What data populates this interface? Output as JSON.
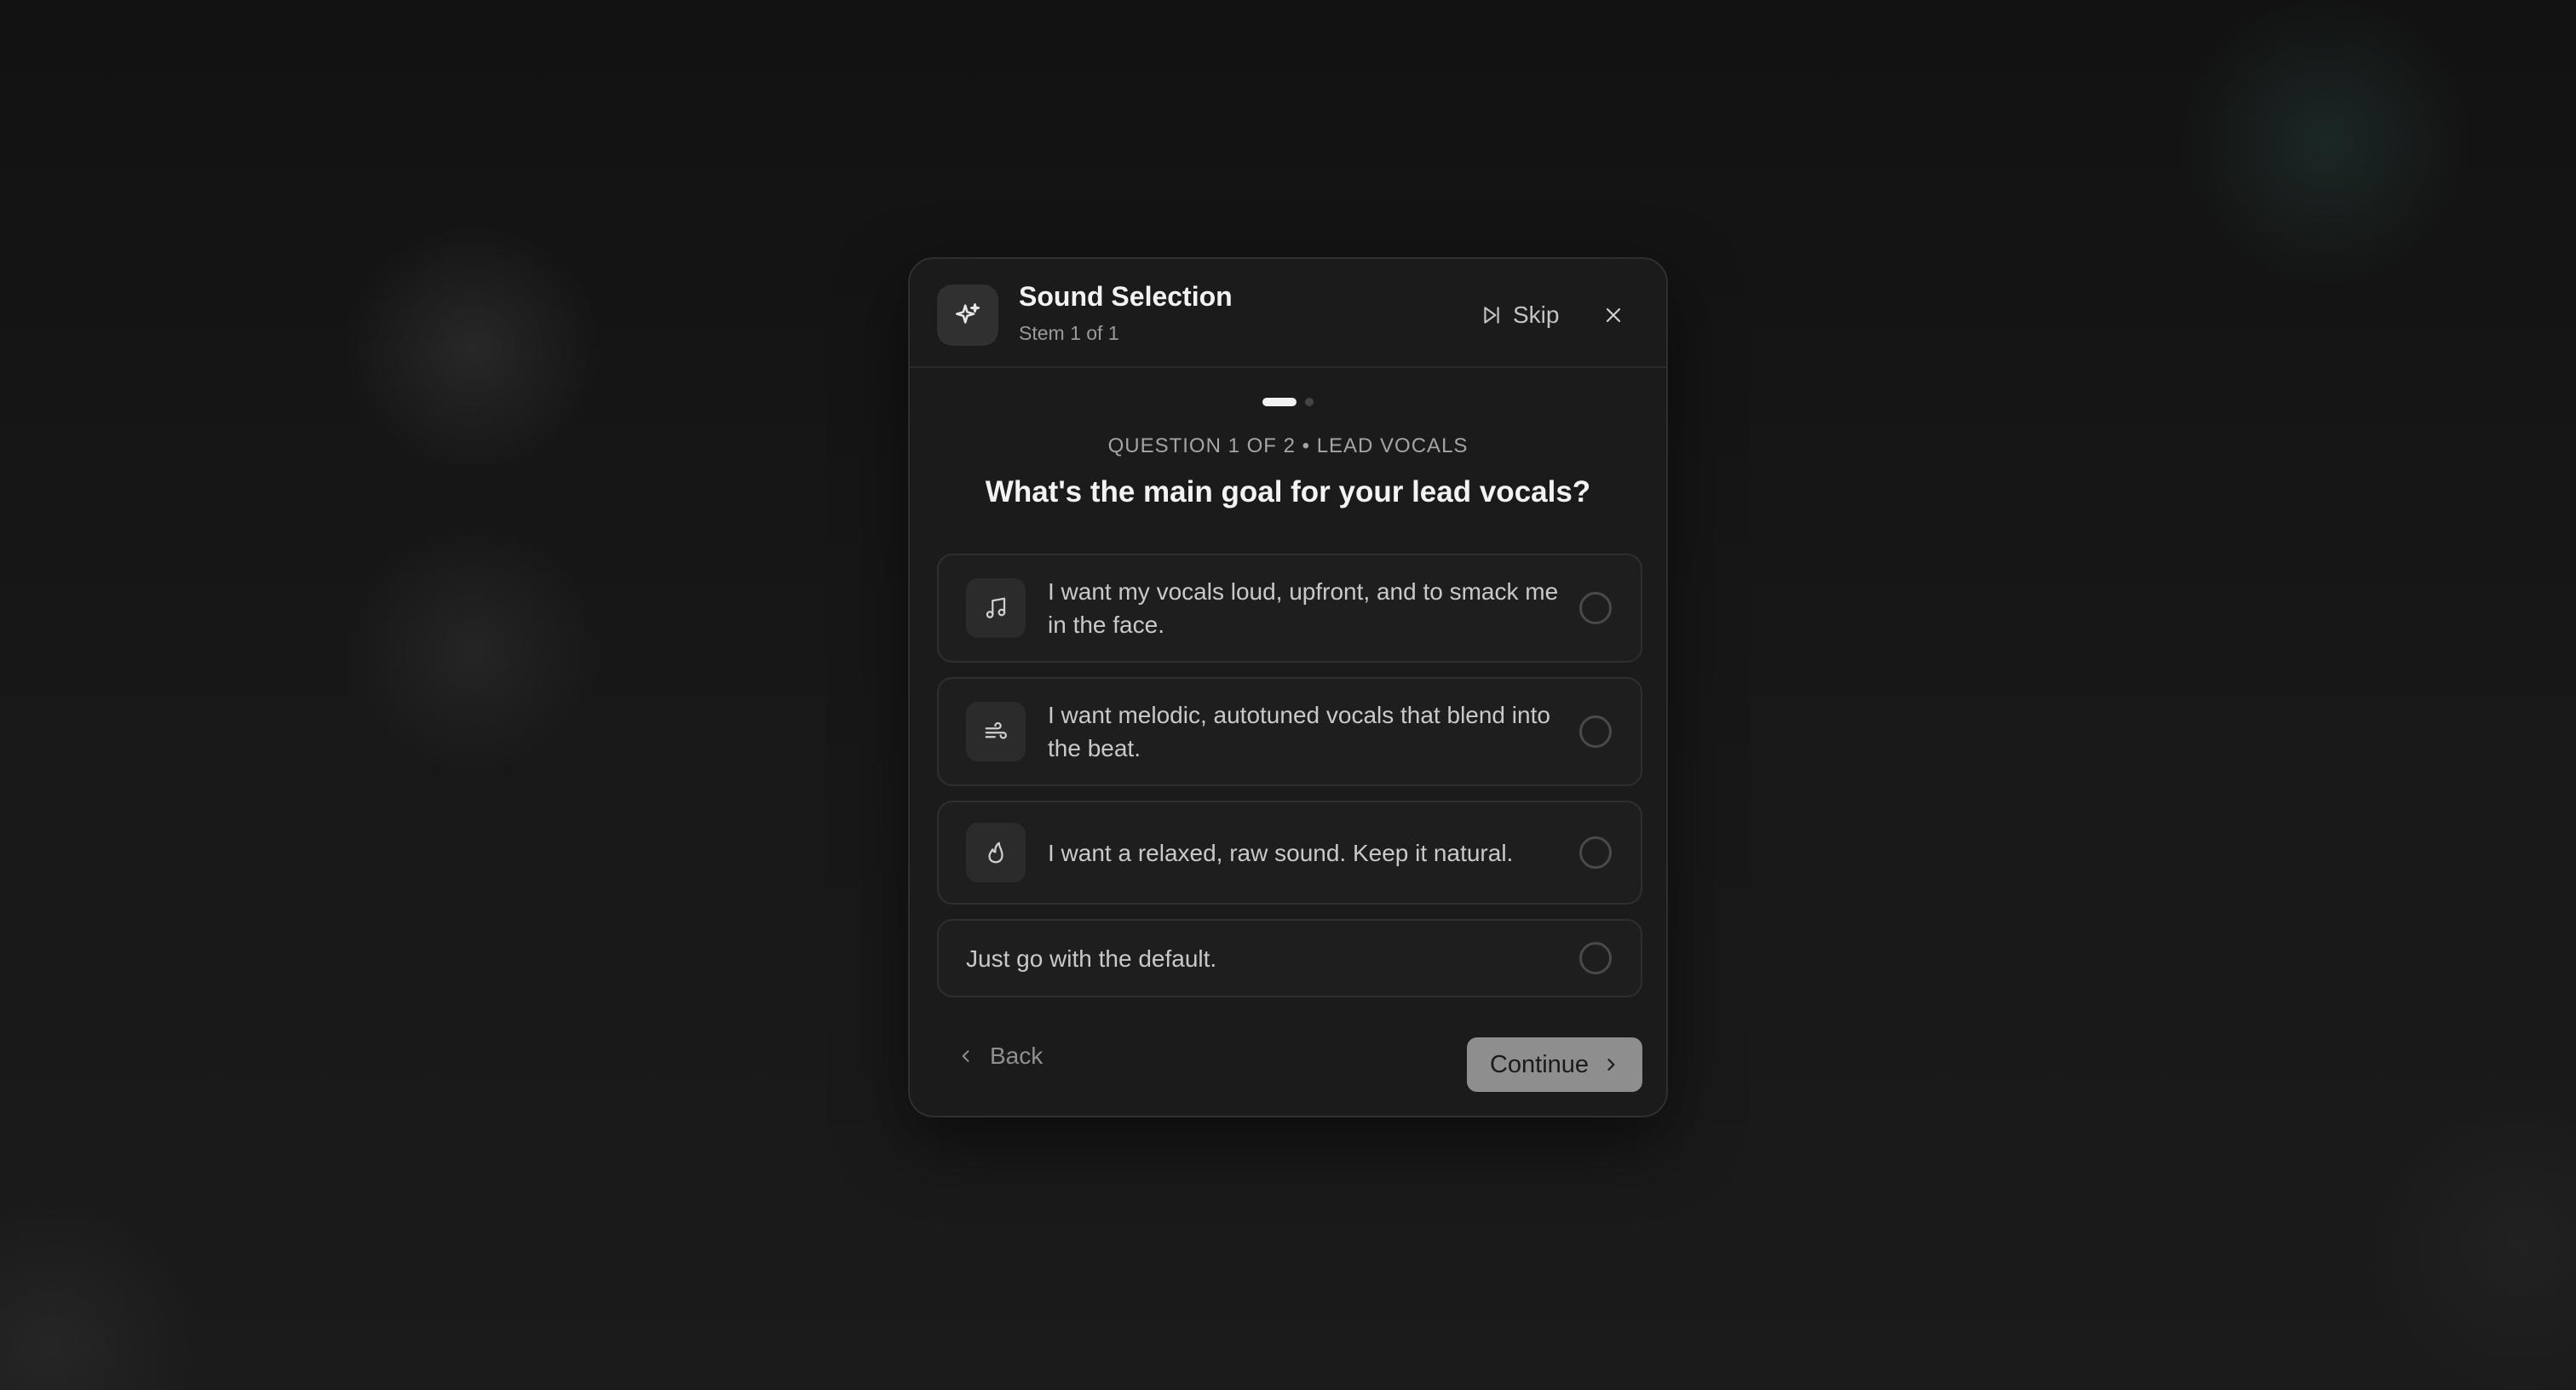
{
  "modal": {
    "title": "Sound Selection",
    "subtitle": "Stem 1 of 1",
    "skip_label": "Skip",
    "header_icon": "sparkles-icon"
  },
  "progress": {
    "current_step": 1,
    "total_steps": 2
  },
  "question": {
    "meta": "QUESTION 1 OF 2 • LEAD VOCALS",
    "text": "What's the main goal for your lead vocals?"
  },
  "options": [
    {
      "icon": "music-note-icon",
      "label": "I want my vocals loud, upfront, and to smack me in the face.",
      "selected": false
    },
    {
      "icon": "wind-icon",
      "label": "I want melodic, autotuned vocals that blend into the beat.",
      "selected": false
    },
    {
      "icon": "flame-icon",
      "label": "I want a relaxed, raw sound. Keep it natural.",
      "selected": false
    },
    {
      "icon": "",
      "label": "Just go with the default.",
      "selected": false
    }
  ],
  "footer": {
    "back_label": "Back",
    "continue_label": "Continue"
  },
  "colors": {
    "modal_background": "#1b1b1b",
    "continue_button": "#8e8e8e",
    "active_dot": "#f2f2f2"
  }
}
